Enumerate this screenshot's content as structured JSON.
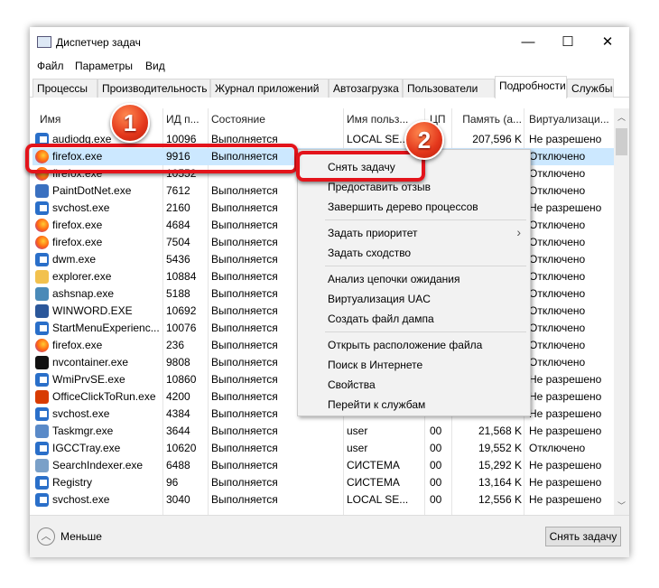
{
  "window": {
    "title": "Диспетчер задач",
    "minimize": "—",
    "maximize": "☐",
    "close": "✕"
  },
  "menu": [
    "Файл",
    "Параметры",
    "Вид"
  ],
  "tabs": [
    {
      "label": "Процессы"
    },
    {
      "label": "Производительность"
    },
    {
      "label": "Журнал приложений"
    },
    {
      "label": "Автозагрузка"
    },
    {
      "label": "Пользователи"
    },
    {
      "label": "Подробности",
      "active": true
    },
    {
      "label": "Службы"
    }
  ],
  "columns": [
    "Имя",
    "ИД п...",
    "Состояние",
    "Имя польз...",
    "ЦП",
    "Память (а...",
    "Виртуализаци..."
  ],
  "rows": [
    [
      "audiodg.exe",
      "10096",
      "Выполняется",
      "LOCAL SE...",
      "",
      "207,596 K",
      "Не разрешено",
      "svc"
    ],
    [
      "firefox.exe",
      "9916",
      "Выполняется",
      "",
      "",
      "",
      "Отключено",
      "ff"
    ],
    [
      "firefox.exe",
      "10552",
      "",
      "",
      "",
      "",
      "Отключено",
      "ff"
    ],
    [
      "PaintDotNet.exe",
      "7612",
      "Выполняется",
      "",
      "",
      "",
      "Отключено",
      "pdn"
    ],
    [
      "svchost.exe",
      "2160",
      "Выполняется",
      "",
      "",
      "",
      "Не разрешено",
      "svc"
    ],
    [
      "firefox.exe",
      "4684",
      "Выполняется",
      "",
      "",
      "",
      "Отключено",
      "ff"
    ],
    [
      "firefox.exe",
      "7504",
      "Выполняется",
      "",
      "",
      "",
      "Отключено",
      "ff"
    ],
    [
      "dwm.exe",
      "5436",
      "Выполняется",
      "",
      "",
      "",
      "Отключено",
      "svc"
    ],
    [
      "explorer.exe",
      "10884",
      "Выполняется",
      "",
      "",
      "",
      "Отключено",
      "folder"
    ],
    [
      "ashsnap.exe",
      "5188",
      "Выполняется",
      "",
      "",
      "",
      "Отключено",
      "gear"
    ],
    [
      "WINWORD.EXE",
      "10692",
      "Выполняется",
      "",
      "",
      "",
      "Отключено",
      "word"
    ],
    [
      "StartMenuExperienc...",
      "10076",
      "Выполняется",
      "",
      "",
      "",
      "Отключено",
      "svc"
    ],
    [
      "firefox.exe",
      "236",
      "Выполняется",
      "",
      "",
      "",
      "Отключено",
      "ff"
    ],
    [
      "nvcontainer.exe",
      "9808",
      "Выполняется",
      "",
      "",
      "",
      "Отключено",
      "nv"
    ],
    [
      "WmiPrvSE.exe",
      "10860",
      "Выполняется",
      "",
      "",
      "",
      "Не разрешено",
      "svc"
    ],
    [
      "OfficeClickToRun.exe",
      "4200",
      "Выполняется",
      "",
      "",
      "",
      "Не разрешено",
      "office"
    ],
    [
      "svchost.exe",
      "4384",
      "Выполняется",
      "",
      "",
      "",
      "Не разрешено",
      "svc"
    ],
    [
      "Taskmgr.exe",
      "3644",
      "Выполняется",
      "user",
      "00",
      "21,568 K",
      "Не разрешено",
      "tm"
    ],
    [
      "IGCCTray.exe",
      "10620",
      "Выполняется",
      "user",
      "00",
      "19,552 K",
      "Отключено",
      "svc"
    ],
    [
      "SearchIndexer.exe",
      "6488",
      "Выполняется",
      "СИСТЕМА",
      "00",
      "15,292 K",
      "Не разрешено",
      "search"
    ],
    [
      "Registry",
      "96",
      "Выполняется",
      "СИСТЕМА",
      "00",
      "13,164 K",
      "Не разрешено",
      "svc"
    ],
    [
      "svchost.exe",
      "3040",
      "Выполняется",
      "LOCAL SE...",
      "00",
      "12,556 K",
      "Не разрешено",
      "svc"
    ]
  ],
  "selected_row": 1,
  "context_menu": [
    "Снять задачу",
    "Предоставить отзыв",
    "Завершить дерево процессов",
    "Задать приоритет",
    "Задать сходство",
    "Анализ цепочки ожидания",
    "Виртуализация UAC",
    "Создать файл дампа",
    "Открыть расположение файла",
    "Поиск в Интернете",
    "Свойства",
    "Перейти к службам"
  ],
  "submenu_arrow": "›",
  "bottom": {
    "less_label": "Меньше",
    "end_task_button": "Снять задачу"
  },
  "badges": [
    "1",
    "2"
  ],
  "colors": {
    "selection": "#cce8ff",
    "highlight": "#e3141b"
  }
}
